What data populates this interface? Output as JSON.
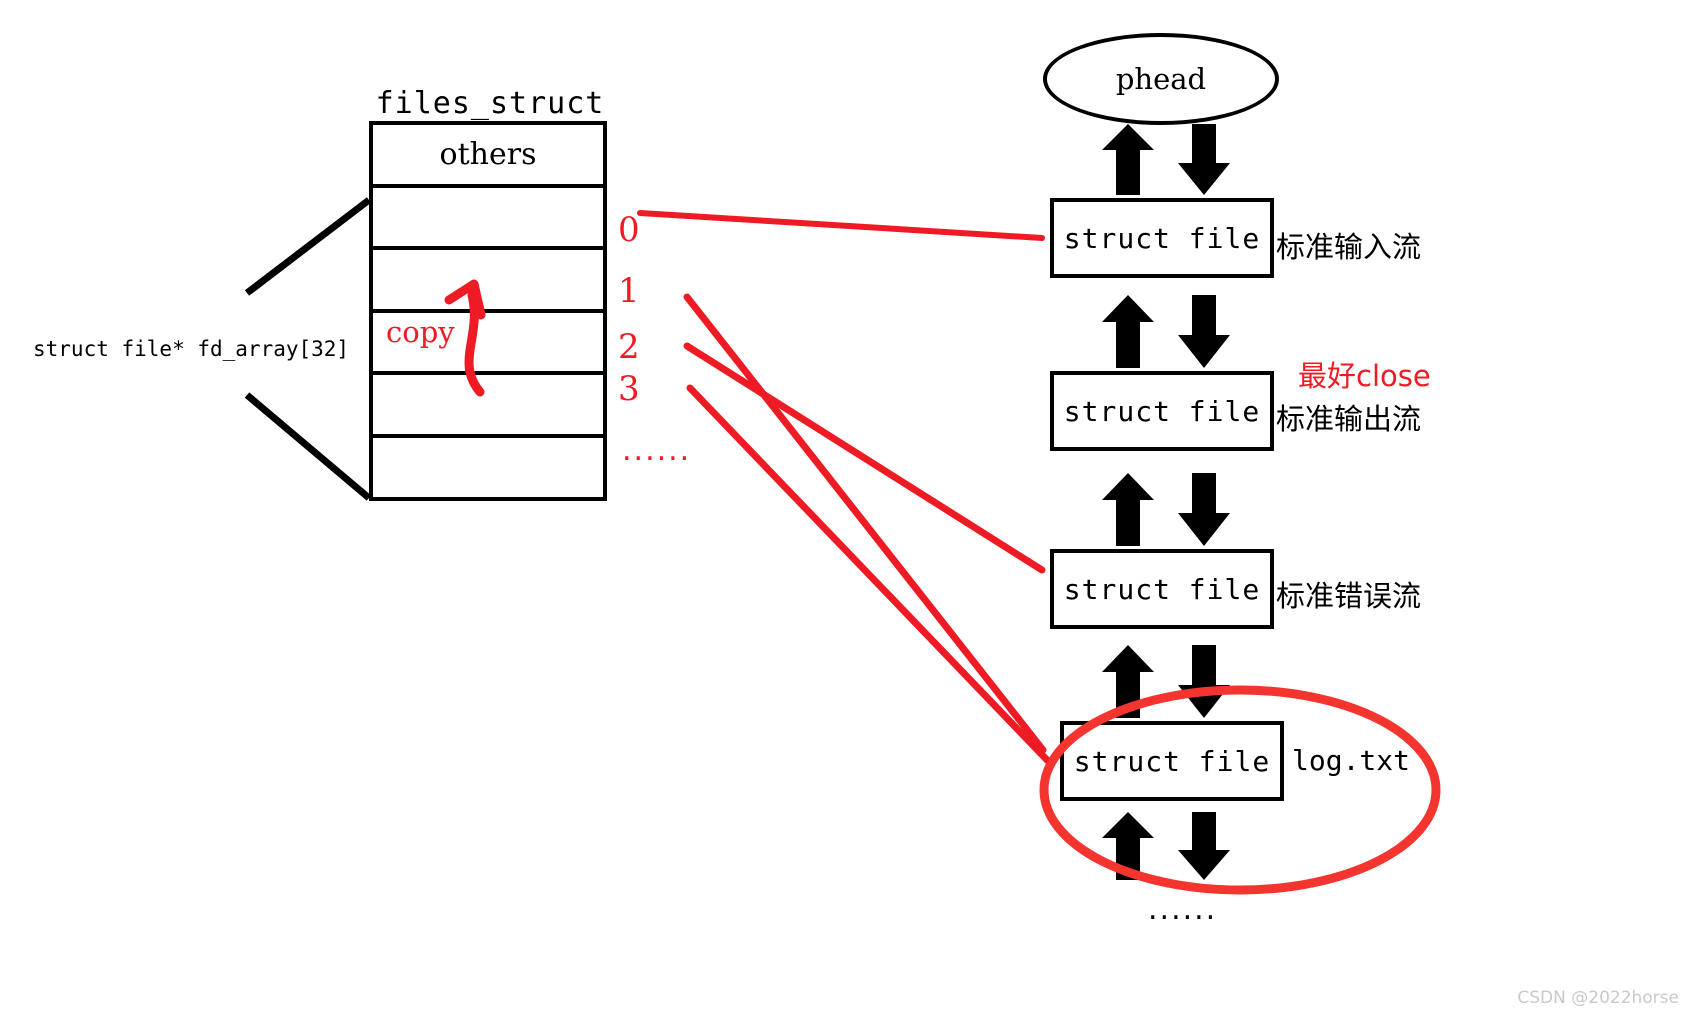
{
  "diagram": {
    "title": "files_struct fd table and open file list",
    "accent_red": "#ee1b24",
    "line_black": "#000000"
  },
  "files_struct": {
    "title": "files_struct",
    "rows": [
      {
        "label": "others"
      },
      {
        "label": ""
      },
      {
        "label": ""
      },
      {
        "label": ""
      },
      {
        "label": ""
      },
      {
        "label": ""
      }
    ],
    "array_label": "struct file* fd_array[32]",
    "copy_label": "copy"
  },
  "fd_indices": {
    "items": [
      "0",
      "1",
      "2",
      "3"
    ],
    "ellipsis": "......"
  },
  "file_list": {
    "head": "phead",
    "nodes": [
      {
        "box": "struct file",
        "label": "标准输入流",
        "note": ""
      },
      {
        "box": "struct file",
        "label": "标准输出流",
        "note": "最好close"
      },
      {
        "box": "struct file",
        "label": "标准错误流",
        "note": ""
      },
      {
        "box": "struct file",
        "label": "log.txt",
        "note": ""
      }
    ],
    "ellipsis": "......"
  },
  "watermark": "CSDN @2022horse"
}
